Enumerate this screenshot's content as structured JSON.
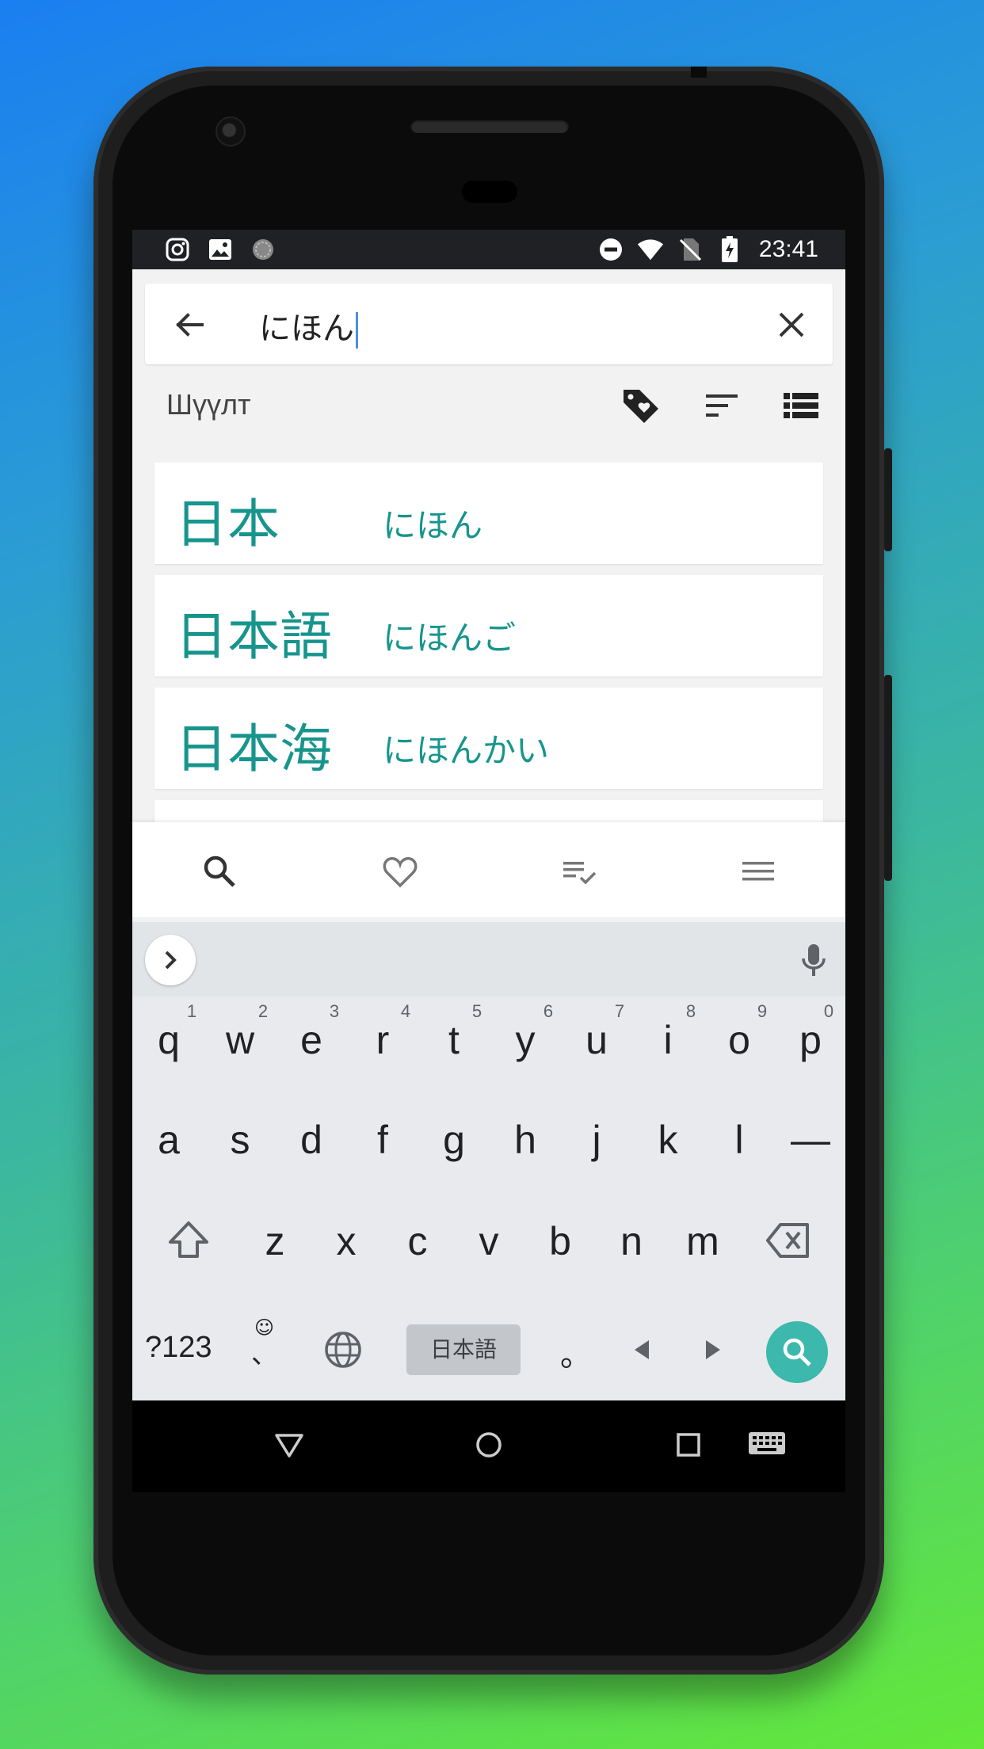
{
  "status_bar": {
    "time": "23:41",
    "left_icons": [
      "instagram-icon",
      "image-icon",
      "sync-icon"
    ],
    "right_icons": [
      "do-not-disturb-icon",
      "wifi-icon",
      "no-sim-icon",
      "battery-charging-icon"
    ]
  },
  "search": {
    "value": "にほん"
  },
  "filter": {
    "label": "Шүүлт"
  },
  "results": [
    {
      "kanji": "日本",
      "kana": "にほん"
    },
    {
      "kanji": "日本語",
      "kana": "にほんご"
    },
    {
      "kanji": "日本海",
      "kana": "にほんかい"
    }
  ],
  "bottom_nav": [
    "search-icon",
    "heart-icon",
    "checklist-icon",
    "menu-icon"
  ],
  "keyboard": {
    "row1": [
      "q",
      "w",
      "e",
      "r",
      "t",
      "y",
      "u",
      "i",
      "o",
      "p"
    ],
    "row1_nums": [
      "1",
      "2",
      "3",
      "4",
      "5",
      "6",
      "7",
      "8",
      "9",
      "0"
    ],
    "row2": [
      "a",
      "s",
      "d",
      "f",
      "g",
      "h",
      "j",
      "k",
      "l",
      "—"
    ],
    "row3": [
      "z",
      "x",
      "c",
      "v",
      "b",
      "n",
      "m"
    ],
    "mode_key": "?123",
    "emoji_key": "☺",
    "comma_key": "、",
    "space_label": "日本語",
    "period_key": "。"
  },
  "colors": {
    "accent": "#17958d",
    "search_button": "#3cb8ac"
  }
}
